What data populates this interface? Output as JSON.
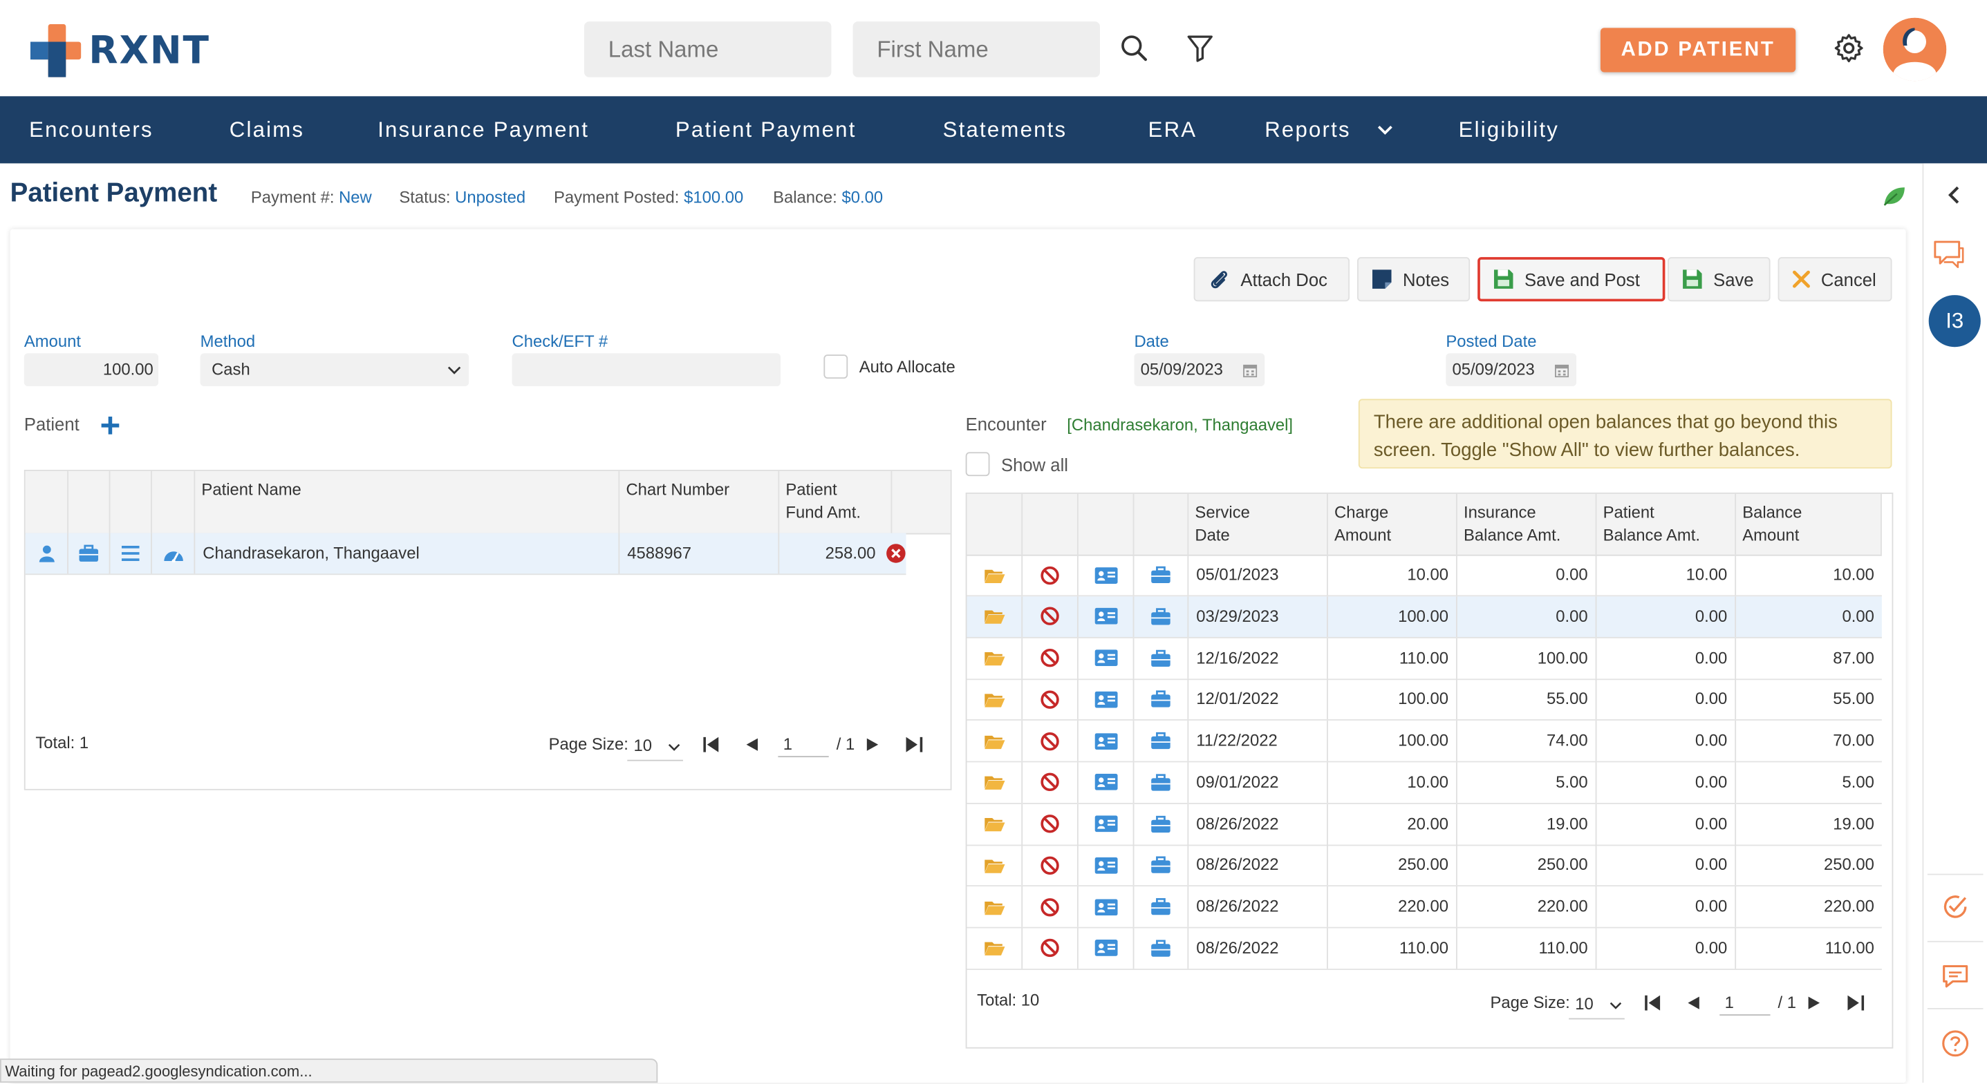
{
  "header": {
    "logo_text": "RXNT",
    "last_name_placeholder": "Last Name",
    "first_name_placeholder": "First Name",
    "add_patient_label": "ADD PATIENT"
  },
  "nav": {
    "items": [
      "Encounters",
      "Claims",
      "Insurance Payment",
      "Patient Payment",
      "Statements",
      "ERA",
      "Reports",
      "Eligibility"
    ]
  },
  "rail": {
    "badge": "I3"
  },
  "page": {
    "title": "Patient Payment",
    "payment_label": "Payment #:",
    "payment_value": "New",
    "status_label": "Status:",
    "status_value": "Unposted",
    "posted_label": "Payment Posted:",
    "posted_value": "$100.00",
    "balance_label": "Balance:",
    "balance_value": "$0.00"
  },
  "toolbar": {
    "attach_doc": "Attach Doc",
    "notes": "Notes",
    "save_and_post": "Save and Post",
    "save": "Save",
    "cancel": "Cancel"
  },
  "form": {
    "amount_label": "Amount",
    "amount_value": "100.00",
    "method_label": "Method",
    "method_value": "Cash",
    "check_label": "Check/EFT #",
    "check_value": "",
    "auto_allocate_label": "Auto Allocate",
    "date_label": "Date",
    "date_value": "05/09/2023",
    "posted_date_label": "Posted Date",
    "posted_date_value": "05/09/2023"
  },
  "patient_section": {
    "label": "Patient",
    "columns": {
      "name": "Patient Name",
      "chart": "Chart Number",
      "fund_line1": "Patient",
      "fund_line2": "Fund Amt."
    },
    "rows": [
      {
        "name": "Chandrasekaron, Thangaavel",
        "chart": "4588967",
        "fund": "258.00"
      }
    ],
    "total": "Total: 1",
    "page_size_label": "Page Size:",
    "page_size": "10",
    "page": "1",
    "page_of": "/ 1"
  },
  "encounter_section": {
    "label": "Encounter",
    "patient_name": "[Chandrasekaron, Thangaavel]",
    "show_all_label": "Show all",
    "notice": "There are additional open balances that go beyond this screen. Toggle \"Show All\" to view further balances.",
    "columns": {
      "service_date": [
        "Service",
        "Date"
      ],
      "charge": [
        "Charge",
        "Amount"
      ],
      "ins_balance": [
        "Insurance",
        "Balance Amt."
      ],
      "pat_balance": [
        "Patient",
        "Balance Amt."
      ],
      "balance": [
        "Balance",
        "Amount"
      ]
    },
    "rows": [
      {
        "date": "05/01/2023",
        "charge": "10.00",
        "ins": "0.00",
        "pat": "10.00",
        "bal": "10.00"
      },
      {
        "date": "03/29/2023",
        "charge": "100.00",
        "ins": "0.00",
        "pat": "0.00",
        "bal": "0.00"
      },
      {
        "date": "12/16/2022",
        "charge": "110.00",
        "ins": "100.00",
        "pat": "0.00",
        "bal": "87.00"
      },
      {
        "date": "12/01/2022",
        "charge": "100.00",
        "ins": "55.00",
        "pat": "0.00",
        "bal": "55.00"
      },
      {
        "date": "11/22/2022",
        "charge": "100.00",
        "ins": "74.00",
        "pat": "0.00",
        "bal": "70.00"
      },
      {
        "date": "09/01/2022",
        "charge": "10.00",
        "ins": "5.00",
        "pat": "0.00",
        "bal": "5.00"
      },
      {
        "date": "08/26/2022",
        "charge": "20.00",
        "ins": "19.00",
        "pat": "0.00",
        "bal": "19.00"
      },
      {
        "date": "08/26/2022",
        "charge": "250.00",
        "ins": "250.00",
        "pat": "0.00",
        "bal": "250.00"
      },
      {
        "date": "08/26/2022",
        "charge": "220.00",
        "ins": "220.00",
        "pat": "0.00",
        "bal": "220.00"
      },
      {
        "date": "08/26/2022",
        "charge": "110.00",
        "ins": "110.00",
        "pat": "0.00",
        "bal": "110.00"
      }
    ],
    "total": "Total: 10",
    "page_size_label": "Page Size:",
    "page_size": "10",
    "page": "1",
    "page_of": "/ 1"
  },
  "statusbar": {
    "text": "Waiting for pagead2.googlesyndication.com..."
  },
  "colors": {
    "brand": "#1d3f66",
    "accent": "#f0834d",
    "link": "#1f6fb5",
    "highlight": "#e03a2f"
  },
  "icons": [
    "search-icon",
    "filter-icon",
    "gear-icon",
    "avatar-icon",
    "paperclip-icon",
    "note-icon",
    "floppy-icon",
    "close-icon",
    "calendar-icon",
    "plus-icon",
    "person-icon",
    "briefcase-icon",
    "list-icon",
    "gauge-icon",
    "remove-icon",
    "folder-icon",
    "block-icon",
    "id-card-icon",
    "chevron-left-icon",
    "chat-icon",
    "check-circle-icon",
    "message-icon",
    "help-icon",
    "leaf-icon"
  ]
}
